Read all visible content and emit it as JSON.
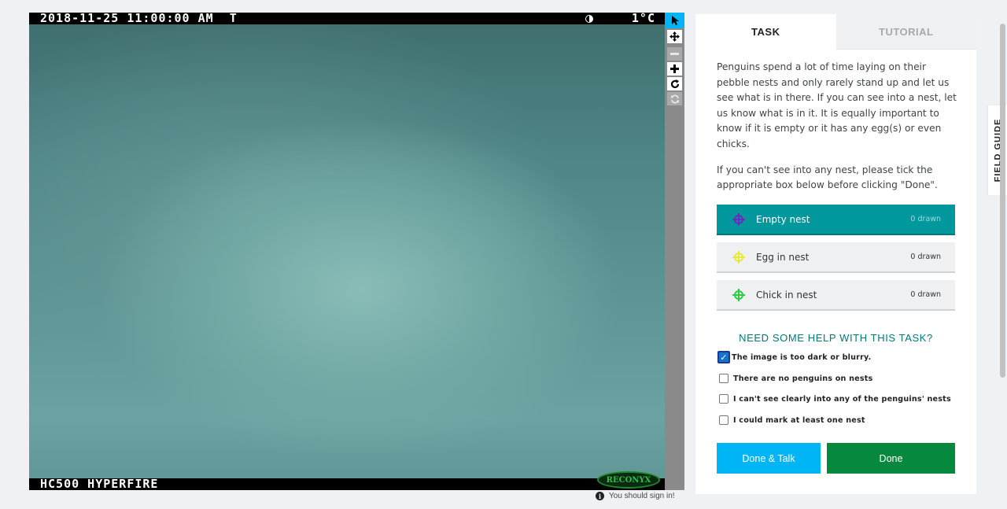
{
  "camera": {
    "datetime": "2018-11-25 11:00:00 AM  T",
    "temperature": "1°C",
    "model": "HC500 HYPERFIRE",
    "brand": "RECONYX"
  },
  "toolbar": {
    "tools": [
      {
        "name": "select",
        "icon": "arrow-cursor-icon",
        "glyph": "➤"
      },
      {
        "name": "pan",
        "icon": "move-arrows-icon",
        "glyph": "✥"
      },
      {
        "name": "zoom-out",
        "icon": "minus-icon",
        "glyph": "−"
      },
      {
        "name": "zoom-in",
        "icon": "plus-icon",
        "glyph": "+"
      },
      {
        "name": "rotate",
        "icon": "rotate-icon",
        "glyph": "↻"
      },
      {
        "name": "reset",
        "icon": "refresh-icon",
        "glyph": "⟳"
      }
    ]
  },
  "signin": {
    "icon": "info-icon",
    "text": "You should sign in!"
  },
  "tabs": {
    "task": "TASK",
    "tutorial": "TUTORIAL"
  },
  "instructions": {
    "p1": "Penguins spend a lot of time laying on their pebble nests and only rarely stand up and let us see what is in there. If you can see into a nest, let us know what is in it. It is equally important to know if it is empty or it has any egg(s) or even chicks.",
    "p2": "If you can't see into any nest, please tick the appropriate box below before clicking \"Done\"."
  },
  "choices": [
    {
      "label": "Empty nest",
      "count": "0 drawn",
      "color": "#6a2bc4",
      "selected": true
    },
    {
      "label": "Egg in nest",
      "count": "0 drawn",
      "color": "#e8e83a",
      "selected": false
    },
    {
      "label": "Chick in nest",
      "count": "0 drawn",
      "color": "#2ecc40",
      "selected": false
    }
  ],
  "help": {
    "title": "NEED SOME HELP WITH THIS TASK?",
    "options": [
      {
        "label": "The image is too dark or blurry.",
        "checked": true
      },
      {
        "label": "There are no penguins on nests",
        "checked": false
      },
      {
        "label": "I can't see clearly into any of the penguins' nests",
        "checked": false
      },
      {
        "label": "I could mark at least one nest",
        "checked": false
      }
    ]
  },
  "buttons": {
    "done_talk": "Done & Talk",
    "done": "Done"
  },
  "field_guide": "FIELD GUIDE"
}
